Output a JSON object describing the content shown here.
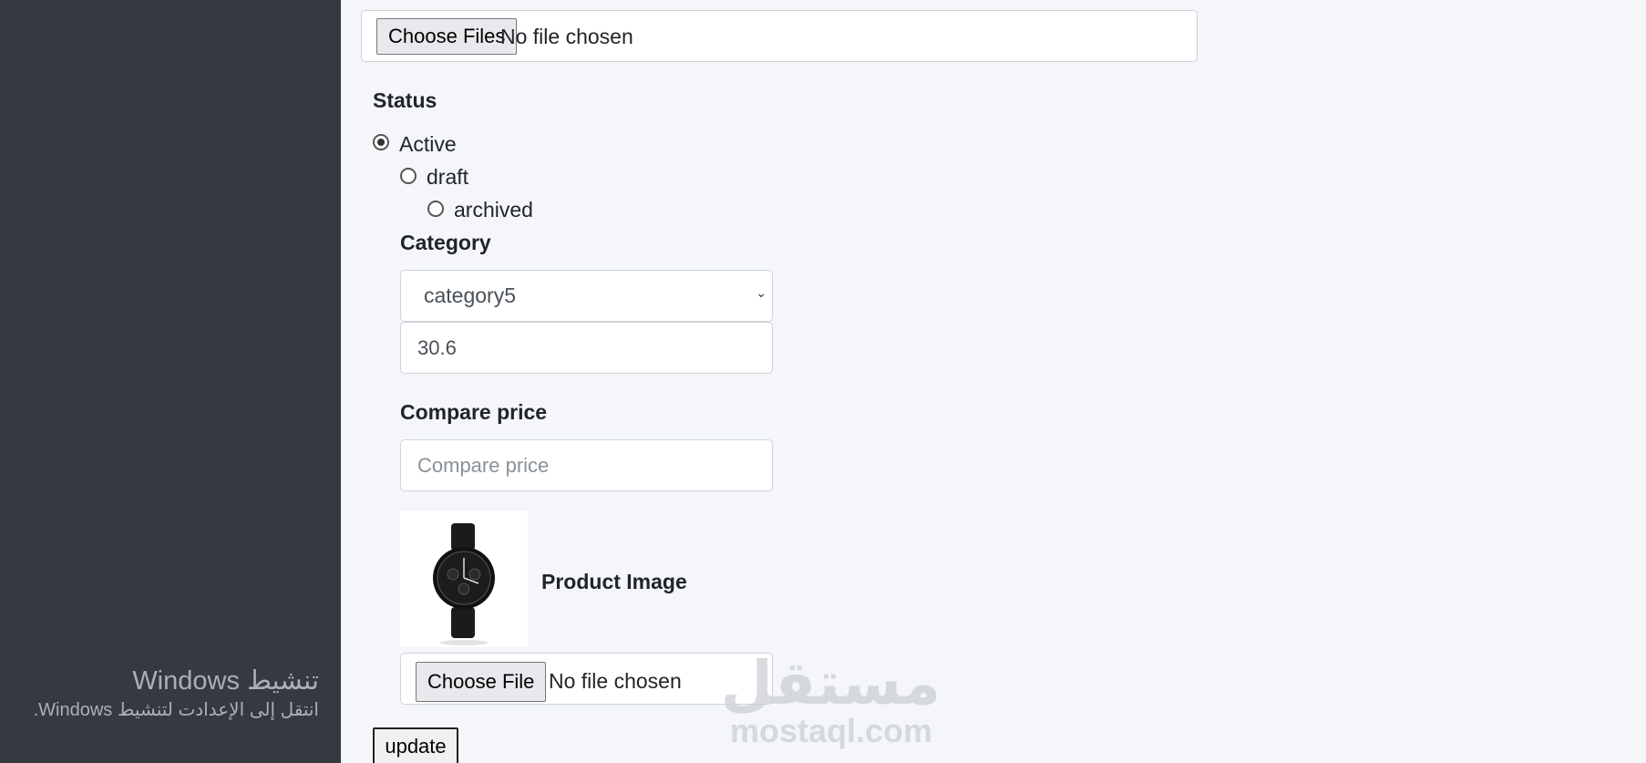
{
  "top_file_input": {
    "button_label": "Choose Files",
    "status": "No file chosen"
  },
  "status": {
    "label": "Status",
    "options": [
      {
        "label": "Active",
        "checked": true
      },
      {
        "label": "draft",
        "checked": false
      },
      {
        "label": "archived",
        "checked": false
      }
    ]
  },
  "category": {
    "label": "Category",
    "selected": "category5"
  },
  "price": {
    "value": "30.6"
  },
  "compare_price": {
    "label": "Compare price",
    "placeholder": "Compare price",
    "value": ""
  },
  "product_image": {
    "label": "Product Image"
  },
  "image_file_input": {
    "button_label": "Choose File",
    "status": "No file chosen"
  },
  "update_button": {
    "label": "update"
  },
  "windows_activation": {
    "title": "تنشيط Windows",
    "subtitle": "انتقل إلى الإعدادت لتنشيط Windows."
  },
  "watermark": {
    "arabic": "مستقل",
    "latin": "mostaql.com"
  }
}
